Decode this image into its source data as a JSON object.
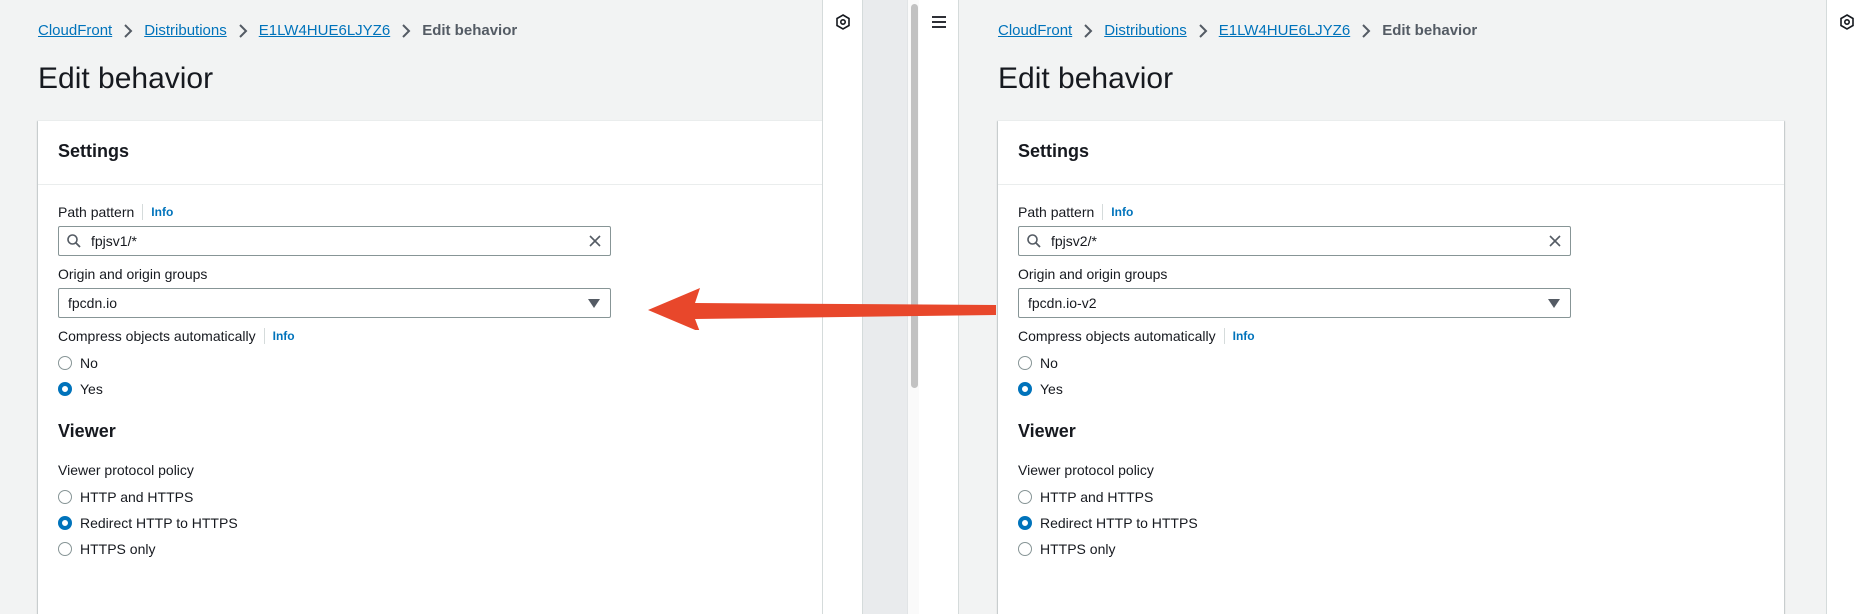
{
  "breadcrumb": {
    "service": "CloudFront",
    "section": "Distributions",
    "distribution_id": "E1LW4HUE6LJYZ6",
    "current": "Edit behavior"
  },
  "page_title": "Edit behavior",
  "left": {
    "settings_title": "Settings",
    "path_pattern_label": "Path pattern",
    "info_label": "Info",
    "path_pattern_value": "fpjsv1/*",
    "origin_label": "Origin and origin groups",
    "origin_value": "fpcdn.io",
    "compress_label": "Compress objects automatically",
    "compress_options": [
      "No",
      "Yes"
    ],
    "compress_selected": "Yes",
    "viewer_title": "Viewer",
    "viewer_protocol_label": "Viewer protocol policy",
    "viewer_options": [
      "HTTP and HTTPS",
      "Redirect HTTP to HTTPS",
      "HTTPS only"
    ],
    "viewer_selected": "Redirect HTTP to HTTPS"
  },
  "right": {
    "settings_title": "Settings",
    "path_pattern_label": "Path pattern",
    "info_label": "Info",
    "path_pattern_value": "fpjsv2/*",
    "origin_label": "Origin and origin groups",
    "origin_value": "fpcdn.io-v2",
    "compress_label": "Compress objects automatically",
    "compress_options": [
      "No",
      "Yes"
    ],
    "compress_selected": "Yes",
    "viewer_title": "Viewer",
    "viewer_protocol_label": "Viewer protocol policy",
    "viewer_options": [
      "HTTP and HTTPS",
      "Redirect HTTP to HTTPS",
      "HTTPS only"
    ],
    "viewer_selected": "Redirect HTTP to HTTPS"
  },
  "colors": {
    "link": "#0073bb",
    "arrow": "#e8472b",
    "background": "#f2f3f3"
  },
  "icons": [
    "search-icon",
    "clear-icon",
    "caret-down-icon",
    "chevron-right-icon",
    "settings-hex-icon",
    "menu-icon",
    "arrow-left-annotation"
  ]
}
